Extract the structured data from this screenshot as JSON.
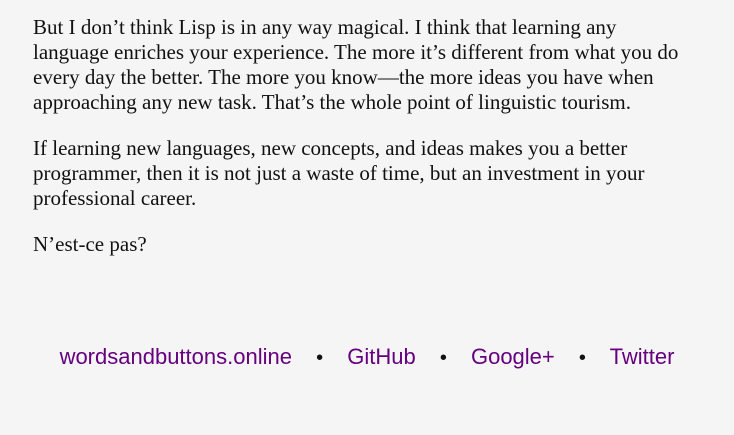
{
  "article": {
    "paragraphs": [
      {
        "lines": [
          "But I don’t think Lisp is in any way magical. I think that learning any",
          "language enriches your experience. The more it’s different from what you do",
          "every day the better. The more you know—the more ideas you have when",
          "approaching any new task. That’s the whole point of linguistic tourism."
        ]
      },
      {
        "lines": [
          "If learning new languages, new concepts, and ideas makes you a better",
          "programmer, then it is not just a waste of time, but an investment in your",
          "professional career."
        ]
      },
      {
        "lines": [
          "N’est-ce pas?"
        ]
      }
    ]
  },
  "footer": {
    "links": [
      "wordsandbuttons.online",
      "GitHub",
      "Google+",
      "Twitter"
    ],
    "separator": "•"
  },
  "colors": {
    "background": "#f5f5f5",
    "text": "#111111",
    "link": "#660080"
  }
}
